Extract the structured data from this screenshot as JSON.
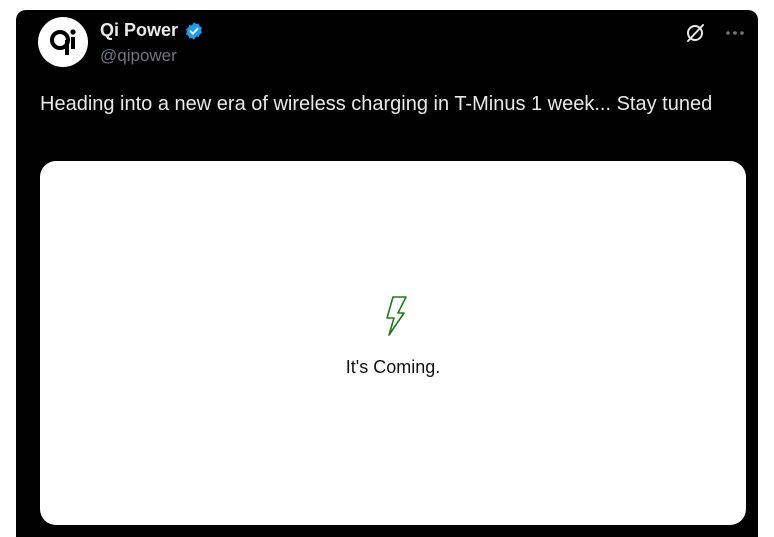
{
  "tweet": {
    "author": {
      "display_name": "Qi Power",
      "handle": "@qipower",
      "verified_icon": "verified-badge-icon",
      "avatar_icon": "qi-logo-icon"
    },
    "text": "Heading into a new era of wireless charging in T-Minus 1 week... Stay tuned",
    "media": {
      "caption": "It's Coming.",
      "icon": "lightning-bolt-icon",
      "icon_color": "#1f7a1f",
      "background": "#ffffff"
    },
    "actions": {
      "grok_icon": "grok-icon",
      "more_icon": "more-options-icon"
    }
  },
  "colors": {
    "background": "#000000",
    "text_primary": "#e7e9ea",
    "text_secondary": "#71767b",
    "verified": "#1d9bf0"
  }
}
